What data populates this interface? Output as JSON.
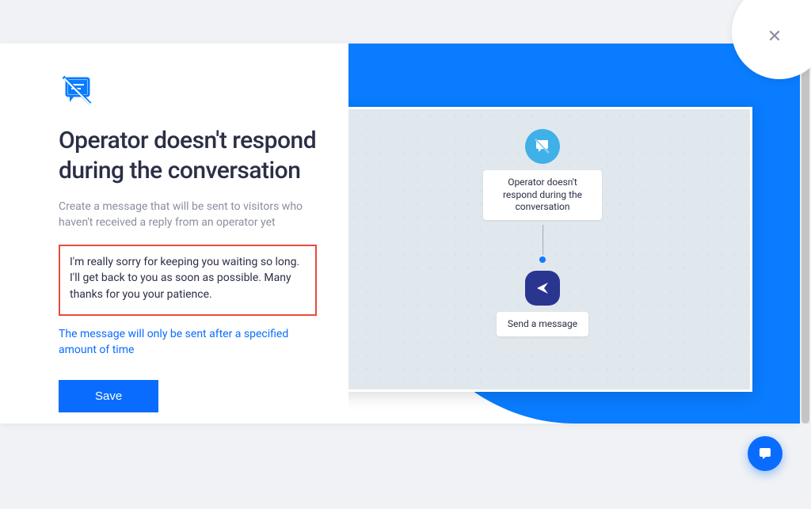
{
  "heading": "Operator doesn't respond during the conversation",
  "subtext": "Create a message that will be sent to visitors who haven't received a reply from an operator yet",
  "message_value": "I'm really sorry for keeping you waiting so long. I'll get back to you as soon as possible. Many thanks for you your patience.",
  "hint": "The message will only be sent after a specified amount of time",
  "save_label": "Save",
  "diagram": {
    "node1_label": "Operator doesn't respond during the conversation",
    "node2_label": "Send a message"
  },
  "colors": {
    "primary": "#0a6cff",
    "accent_blue": "#0a7cff",
    "highlight_border": "#e74c3c"
  }
}
